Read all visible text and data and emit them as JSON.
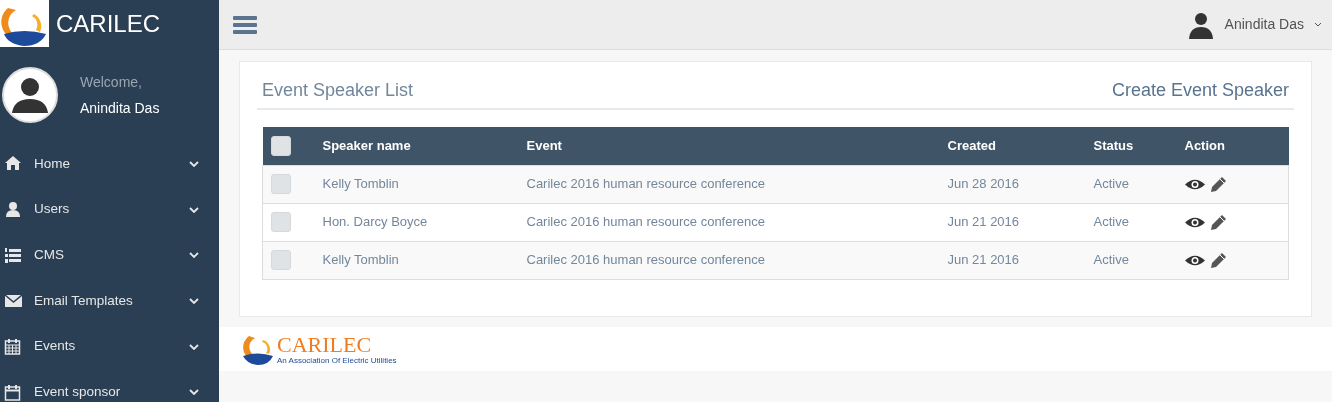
{
  "sidebar": {
    "brand": "CARILEC",
    "welcome": "Welcome,",
    "user_name": "Anindita Das",
    "items": [
      {
        "label": "Home"
      },
      {
        "label": "Users"
      },
      {
        "label": "CMS"
      },
      {
        "label": "Email Templates"
      },
      {
        "label": "Events"
      },
      {
        "label": "Event sponsor"
      }
    ]
  },
  "topbar": {
    "user_name": "Anindita Das"
  },
  "panel": {
    "title": "Event Speaker List",
    "create_link": "Create Event Speaker",
    "table": {
      "header_checked": false,
      "columns": [
        "Speaker name",
        "Event",
        "Created",
        "Status",
        "Action"
      ],
      "rows": [
        {
          "checked": false,
          "cells": [
            "Kelly Tomblin",
            "Carilec 2016 human resource conference",
            "Jun 28 2016",
            "Active"
          ]
        },
        {
          "checked": false,
          "cells": [
            "Hon. Darcy Boyce",
            "Carilec 2016 human resource conference",
            "Jun 21 2016",
            "Active"
          ]
        },
        {
          "checked": false,
          "cells": [
            "Kelly Tomblin",
            "Carilec 2016 human resource conference",
            "Jun 21 2016",
            "Active"
          ]
        }
      ]
    }
  },
  "footer": {
    "brand": "CARILEC",
    "tagline": "An Association Of Electric Utilities"
  }
}
